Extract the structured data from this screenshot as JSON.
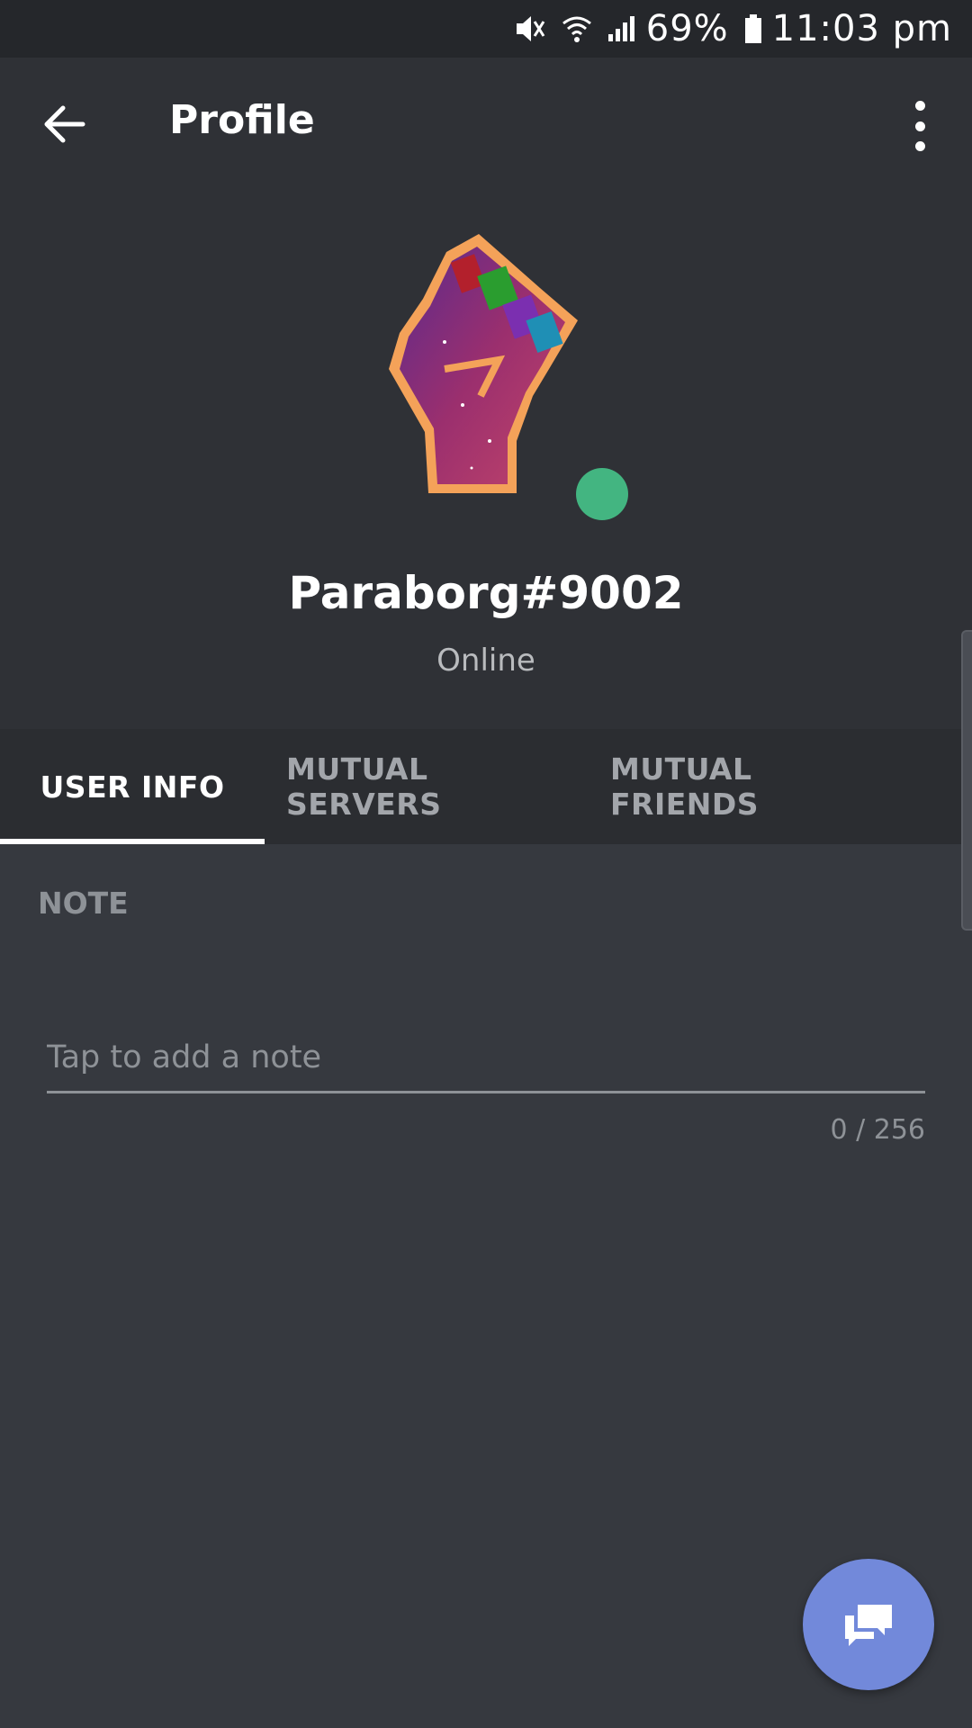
{
  "statusbar": {
    "battery": "69%",
    "time": "11:03 pm",
    "icons": [
      "mute-icon",
      "wifi-icon",
      "signal-icon",
      "battery-icon"
    ]
  },
  "header": {
    "title": "Profile",
    "back_icon": "arrow-left-icon",
    "menu_icon": "more-vertical-icon"
  },
  "profile": {
    "username": "Paraborg#9002",
    "status": "Online",
    "status_color": "#43b581",
    "avatar_icon": "raised-fist-avatar"
  },
  "tabs": [
    {
      "label": "USER INFO",
      "active": true
    },
    {
      "label": "MUTUAL SERVERS",
      "active": false
    },
    {
      "label": "MUTUAL FRIENDS",
      "active": false
    }
  ],
  "note": {
    "label": "NOTE",
    "placeholder": "Tap to add a note",
    "value": "",
    "counter": "0 / 256"
  },
  "fab": {
    "icon": "chat-bubbles-icon",
    "color": "#7289da"
  },
  "colors": {
    "background": "#36393f",
    "header": "#2f3136",
    "accent": "#7289da"
  }
}
